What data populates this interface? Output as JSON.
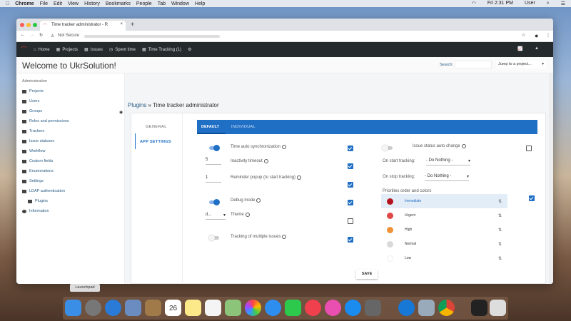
{
  "menubar": {
    "items": [
      "Chrome",
      "File",
      "Edit",
      "View",
      "History",
      "Bookmarks",
      "People",
      "Tab",
      "Window",
      "Help"
    ],
    "clock": "Fri 2:31 PM",
    "user": "User"
  },
  "browser": {
    "tab_title": "Time tracker administrator - R",
    "security": "Not Secure"
  },
  "nav": {
    "items": [
      "Home",
      "Projects",
      "Issues",
      "Spent time",
      "Time Tracking (1)"
    ]
  },
  "header": {
    "title": "Welcome to UkrSolution!",
    "search_label": "Search:",
    "search_value": "",
    "jump": "Jump to a project..."
  },
  "sidebar": {
    "heading": "Administration",
    "items": [
      "Projects",
      "Users",
      "Groups",
      "Roles and permissions",
      "Trackers",
      "Issue statuses",
      "Workflow",
      "Custom fields",
      "Enumerations",
      "Settings",
      "LDAP authentication",
      "Plugins",
      "Information"
    ]
  },
  "breadcrumb": {
    "link": "Plugins",
    "sep": " » ",
    "current": "Time tracker administrator"
  },
  "left_tabs": [
    "GENERAL",
    "APP SETTINGS"
  ],
  "tabs": [
    "DEFAULT",
    "INDIVIDUAL"
  ],
  "settings": [
    {
      "label": "Time auto synchronization",
      "control": "toggle",
      "on": true,
      "checked": true
    },
    {
      "label": "Inactivity timeout",
      "control": "input",
      "value": "5",
      "checked": true
    },
    {
      "label": "Reminder popup (to start tracking)",
      "control": "input",
      "value": "1",
      "checked": true
    },
    {
      "label": "Debug mode",
      "control": "toggle",
      "on": true,
      "checked": true
    },
    {
      "label": "Theme",
      "control": "select",
      "value": "d...",
      "checked": false
    },
    {
      "label": "Tracking of multiple issues",
      "control": "toggle",
      "on": false,
      "checked": true
    }
  ],
  "right": {
    "issue_status": {
      "label": "Issue status auto change",
      "on": false,
      "checked": false
    },
    "start_label": "On start tracking:",
    "start_value": "- Do Nothing -",
    "stop_label": "On stop tracking:",
    "stop_value": "- Do Nothing -",
    "priorities_label": "Priorities order and colors",
    "priorities_checked": true,
    "priorities": [
      {
        "name": "Immediate",
        "color": "#b3141e"
      },
      {
        "name": "Urgent",
        "color": "#e04848"
      },
      {
        "name": "High",
        "color": "#f0923a"
      },
      {
        "name": "Normal",
        "color": "#d9d9d9"
      },
      {
        "name": "Low",
        "color": "#ffffff"
      }
    ]
  },
  "save": "SAVE",
  "dock": {
    "tooltip": "Launchpad",
    "calendar_day": "26"
  }
}
